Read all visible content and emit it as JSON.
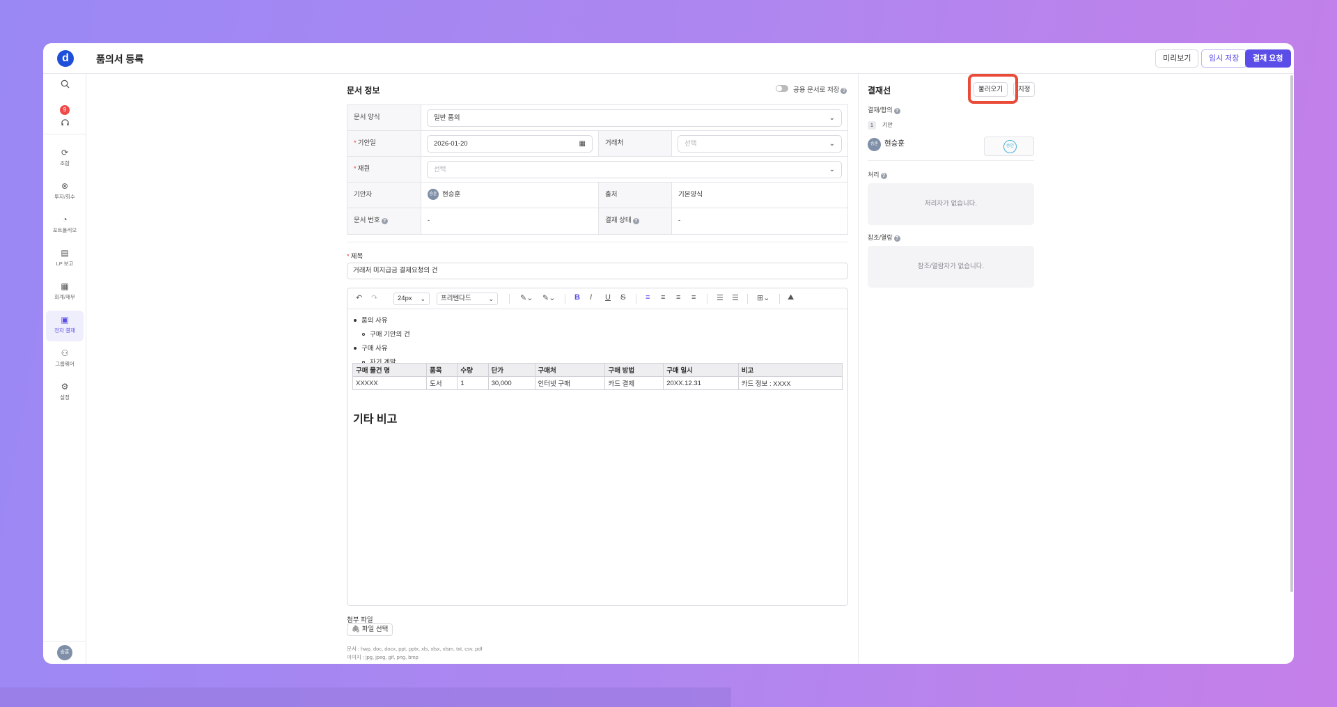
{
  "header": {
    "logo_letter": "d",
    "page_title": "품의서 등록",
    "btn_preview": "미리보기",
    "btn_temp_save": "임시 저장",
    "btn_request": "결재 요청"
  },
  "sidebar": {
    "notification_count": "9",
    "items": [
      {
        "label": "조합",
        "icon": "union-icon"
      },
      {
        "label": "투자/회수",
        "icon": "investment-icon"
      },
      {
        "label": "포트폴리오",
        "icon": "portfolio-icon"
      },
      {
        "label": "LP 보고",
        "icon": "lp-report-icon"
      },
      {
        "label": "회계/재무",
        "icon": "accounting-icon"
      },
      {
        "label": "전자 결재",
        "icon": "approval-icon",
        "active": true
      },
      {
        "label": "그룹웨어",
        "icon": "groupware-icon"
      },
      {
        "label": "설정",
        "icon": "settings-icon"
      }
    ],
    "user_avatar": "승훈"
  },
  "document_info": {
    "section_title": "문서 정보",
    "share_toggle_label": "공용 문서로 저장",
    "rows": {
      "doc_type_label": "문서 양식",
      "doc_type_value": "일반 품의",
      "draft_date_label": "기안일",
      "draft_date_value": "2026-01-20",
      "vendor_label": "거래처",
      "vendor_placeholder": "선택",
      "fund_label": "재원",
      "fund_placeholder": "선택",
      "drafter_label": "기안자",
      "drafter_avatar": "승훈",
      "drafter_name": "현승훈",
      "source_label": "출처",
      "source_value": "기본양식",
      "doc_number_label": "문서 번호",
      "doc_number_value": "-",
      "approval_status_label": "결재 상태",
      "approval_status_value": "-"
    }
  },
  "title_field": {
    "label": "제목",
    "value": "거래처 미지급금 결제요청의 건"
  },
  "editor": {
    "font_size": "24px",
    "font_family": "프리텐다드",
    "bullets": [
      {
        "level": 1,
        "text": "품의 사유"
      },
      {
        "level": 2,
        "text": "구매 기안의 건"
      },
      {
        "level": 1,
        "text": "구매 사유"
      },
      {
        "level": 2,
        "text": "자기 계발"
      }
    ],
    "table": {
      "headers": [
        "구매 물건 명",
        "품목",
        "수량",
        "단가",
        "구매처",
        "구매 방법",
        "구매 일시",
        "비고"
      ],
      "rows": [
        [
          "XXXXX",
          "도서",
          "1",
          "30,000",
          "인터넷 구매",
          "카드 결제",
          "20XX.12.31",
          "카드 정보 : XXXX"
        ]
      ]
    },
    "heading": "기타 비고"
  },
  "attachment": {
    "label": "첨부 파일",
    "button": "파일 선택",
    "note_docs": "문서 : hwp, doc, docx, ppt, pptx, xls, xlsx, xlsm, txt, csv, pdf",
    "note_images": "이미지 : jpg, jpeg, gif, png, bmp"
  },
  "approval_line": {
    "title": "결재선",
    "btn_load": "불러오기",
    "btn_assign": "지정",
    "approval_label": "결재/합의",
    "step_number": "1",
    "step_name": "기안",
    "approver_avatar": "승훈",
    "approver_name": "현승훈",
    "stamp_text": "승인",
    "process_label": "처리",
    "process_empty": "처리자가 없습니다.",
    "ref_label": "참조/열람",
    "ref_empty": "참조/열람자가 없습니다."
  },
  "colors": {
    "accent": "#5b4ee8",
    "highlight": "#ea4a38",
    "required": "#e53935"
  }
}
